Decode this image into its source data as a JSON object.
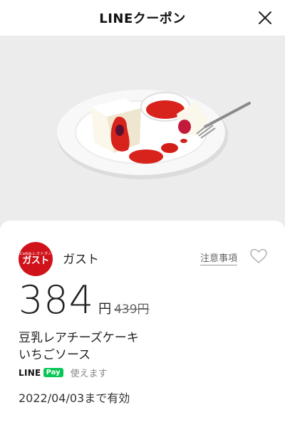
{
  "header": {
    "title": "LINEクーポン"
  },
  "coupon": {
    "store_logo_top": "Café&レストラン",
    "store_logo_main": "ガスト",
    "store_name": "ガスト",
    "notes_label": "注意事項",
    "price": "384",
    "yen": "円",
    "original_price": "439円",
    "product_line1": "豆乳レアチーズケーキ",
    "product_line2": "いちごソース",
    "linepay_line": "LINE",
    "linepay_pay": "Pay",
    "payment_text": "使えます",
    "expiry": "2022/04/03まで有効"
  },
  "colors": {
    "brand_red": "#d0121b",
    "line_green": "#06c755",
    "sauce_red": "#d8231c"
  },
  "icons": {
    "close": "close-icon",
    "favorite": "heart-icon"
  }
}
